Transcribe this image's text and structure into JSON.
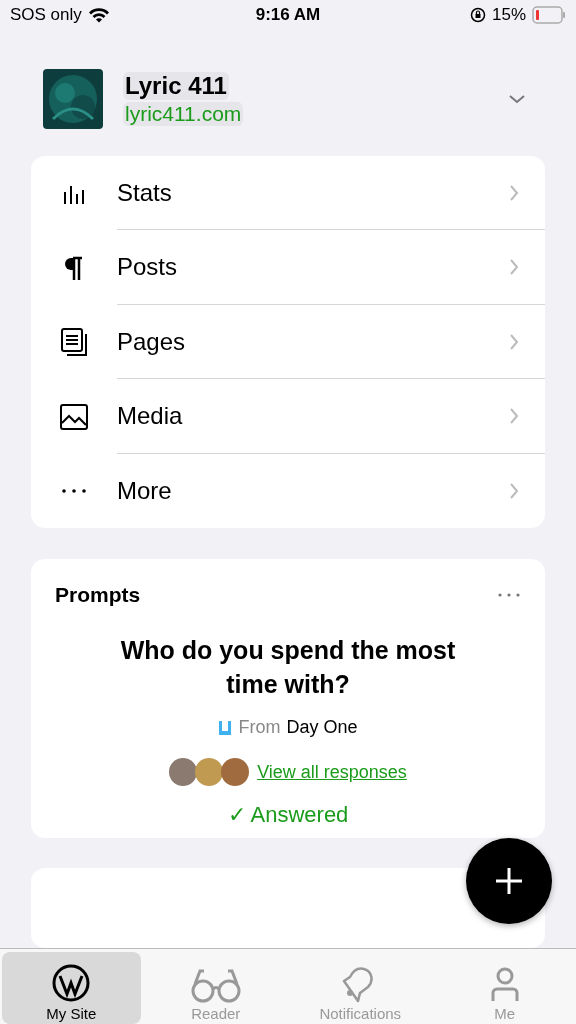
{
  "status_bar": {
    "carrier": "SOS only",
    "time": "9:16 AM",
    "battery": "15%"
  },
  "site": {
    "name": "Lyric 411",
    "url": "lyric411.com"
  },
  "menu": [
    {
      "label": "Stats",
      "kind": "stats"
    },
    {
      "label": "Posts",
      "kind": "posts"
    },
    {
      "label": "Pages",
      "kind": "pages"
    },
    {
      "label": "Media",
      "kind": "media"
    },
    {
      "label": "More",
      "kind": "more"
    }
  ],
  "prompts": {
    "title": "Prompts",
    "question": "Who do you spend the most time with?",
    "source_prefix": "From",
    "source": "Day One",
    "link": "View all responses",
    "status": "✓ Answered"
  },
  "tabs": [
    {
      "label": "My Site",
      "selected": true,
      "kind": "site"
    },
    {
      "label": "Reader",
      "selected": false,
      "kind": "reader"
    },
    {
      "label": "Notifications",
      "selected": false,
      "kind": "bell"
    },
    {
      "label": "Me",
      "selected": false,
      "kind": "person"
    }
  ]
}
